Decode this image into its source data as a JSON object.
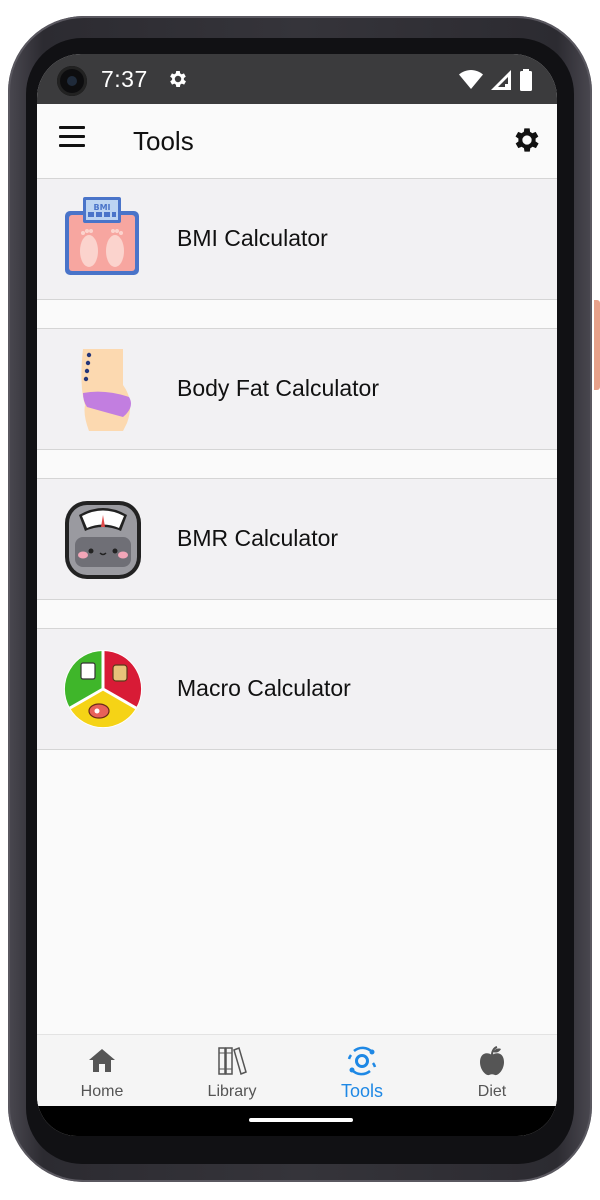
{
  "status_bar": {
    "time": "7:37",
    "icons": [
      "settings-icon",
      "wifi-icon",
      "signal-icon",
      "battery-icon"
    ]
  },
  "app_bar": {
    "title": "Tools",
    "menu_icon": "menu-icon",
    "settings_icon": "settings-icon"
  },
  "tools": [
    {
      "label": "BMI Calculator",
      "icon": "bmi-scale-icon"
    },
    {
      "label": "Body Fat Calculator",
      "icon": "body-fat-icon"
    },
    {
      "label": "BMR Calculator",
      "icon": "bmr-scale-icon"
    },
    {
      "label": "Macro Calculator",
      "icon": "macro-pie-icon"
    }
  ],
  "bottom_nav": {
    "items": [
      {
        "label": "Home",
        "icon": "home-icon"
      },
      {
        "label": "Library",
        "icon": "library-icon"
      },
      {
        "label": "Tools",
        "icon": "tools-icon"
      },
      {
        "label": "Diet",
        "icon": "apple-icon"
      }
    ],
    "active": "Tools",
    "active_color": "#1e88e5"
  },
  "colors": {
    "status_bar": "#3b3b3d",
    "list_item_bg": "#f2f1f3",
    "accent": "#1e88e5"
  }
}
